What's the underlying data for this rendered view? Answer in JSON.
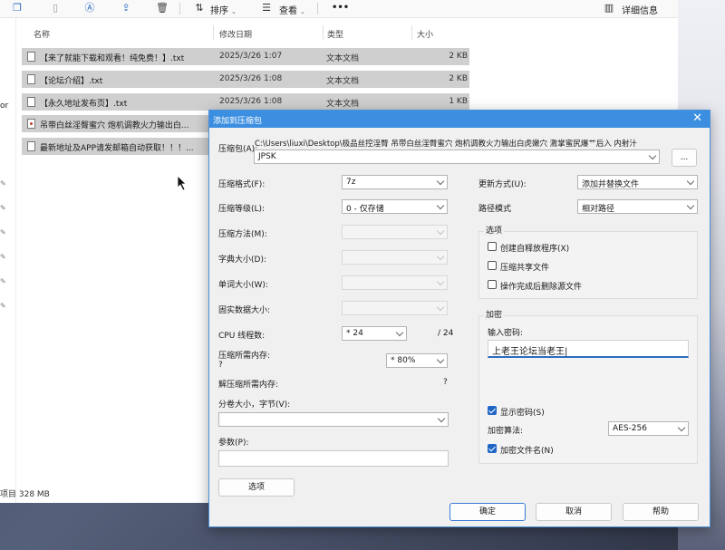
{
  "explorer": {
    "toolbar": {
      "sort": "排序",
      "view": "查看",
      "more": "•••",
      "details": "详细信息"
    },
    "nav_label": "or",
    "columns": {
      "name": "名称",
      "date": "修改日期",
      "type": "类型",
      "size": "大小"
    },
    "files": [
      {
        "name": "【来了就能下载和观看！纯免费！】.txt",
        "date": "2025/3/26 1:07",
        "type": "文本文档",
        "size": "2 KB"
      },
      {
        "name": "【论坛介绍】.txt",
        "date": "2025/3/26 1:08",
        "type": "文本文档",
        "size": "2 KB"
      },
      {
        "name": "【永久地址发布页】.txt",
        "date": "2025/3/26 1:08",
        "type": "文本文档",
        "size": "1 KB"
      },
      {
        "name": "吊带白丝淫臀蜜穴 炮机调教火力输出白...",
        "date": "",
        "type": "",
        "size": ""
      },
      {
        "name": "最新地址及APP请发邮箱自动获取！！！...",
        "date": "",
        "type": "",
        "size": ""
      }
    ],
    "status": "项目  328 MB"
  },
  "dialog": {
    "title": "添加到压缩包",
    "archive_label": "压缩包(A):",
    "archive_path": "C:\\Users\\liuxi\\Desktop\\极品丝控淫臀 吊带白丝淫臀蜜穴 炮机调教火力输出白虎嫩穴 激掌蜜尻爆艹后入 内射汁",
    "archive_path2": "JPSK",
    "browse": "...",
    "format_label": "压缩格式(F):",
    "format_value": "7z",
    "level_label": "压缩等级(L):",
    "level_value": "0 - 仅存储",
    "method_label": "压缩方法(M):",
    "dict_label": "字典大小(D):",
    "word_label": "单词大小(W):",
    "solid_label": "固实数据大小:",
    "cpu_label": "CPU 线程数:",
    "cpu_value": "* 24",
    "cpu_total": "/ 24",
    "mem_label": "压缩所需内存:",
    "mem_q": "?",
    "mem_value": "* 80%",
    "decomp_label": "解压缩所需内存:",
    "decomp_q": "?",
    "volume_label": "分卷大小，字节(V):",
    "params_label": "参数(P):",
    "options_button": "选项",
    "update_label": "更新方式(U):",
    "update_value": "添加并替换文件",
    "path_label": "路径模式",
    "path_value": "相对路径",
    "options_group": "选项",
    "opt_sfx": "创建自释放程序(X)",
    "opt_shared": "压缩共享文件",
    "opt_delete": "操作完成后删除源文件",
    "enc_group": "加密",
    "pwd_label": "输入密码:",
    "pwd_value": "上老王论坛当老王|",
    "show_pwd": "显示密码(S)",
    "enc_method_label": "加密算法:",
    "enc_method_value": "AES-256",
    "enc_names": "加密文件名(N)",
    "ok": "确定",
    "cancel": "取消",
    "help": "帮助"
  }
}
